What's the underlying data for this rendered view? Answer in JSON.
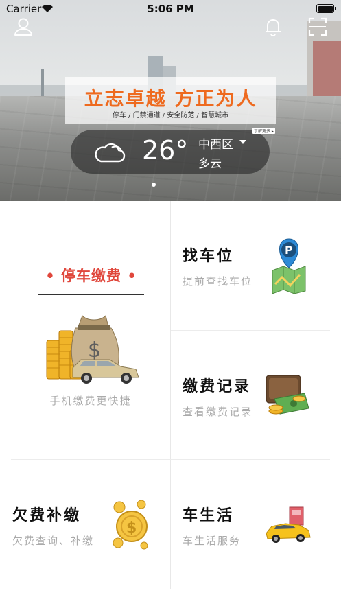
{
  "status_bar": {
    "carrier": "Carrier",
    "time": "5:06 PM"
  },
  "banner": {
    "slogan": "立志卓越  方正为人",
    "subtitle": "停车 / 门禁通道 / 安全防范 / 智慧城市",
    "tag": "了解更多 ▸"
  },
  "weather": {
    "temperature": "26°",
    "district": "中西区",
    "condition": "多云"
  },
  "carousel": {
    "current_page": 1,
    "page_count": 1
  },
  "features": {
    "parking_payment": {
      "title": "停车缴费",
      "subtitle": "手机缴费更快捷"
    },
    "find_spot": {
      "title": "找车位",
      "subtitle": "提前查找车位"
    },
    "payment_records": {
      "title": "缴费记录",
      "subtitle": "查看缴费记录"
    },
    "arrears": {
      "title": "欠费补缴",
      "subtitle": "欠费查询、补缴"
    },
    "car_life": {
      "title": "车生活",
      "subtitle": "车生活服务"
    }
  },
  "colors": {
    "accent": "#e0473c",
    "banner_orange": "#ee6a1f"
  }
}
